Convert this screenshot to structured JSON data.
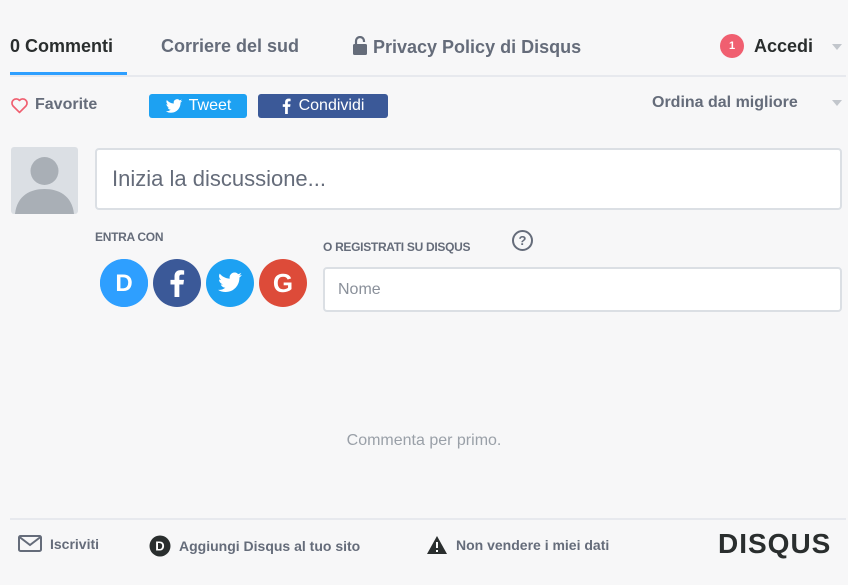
{
  "nav": {
    "comments_tab": "0 Commenti",
    "community_tab": "Corriere del sud",
    "privacy_tab": "Privacy Policy di Disqus",
    "notification_count": "1",
    "login": "Accedi"
  },
  "actions": {
    "favorite": "Favorite",
    "tweet": "Tweet",
    "share": "Condividi",
    "sort": "Ordina dal migliore"
  },
  "composer": {
    "placeholder": "Inizia la discussione..."
  },
  "login": {
    "label": "ENTRA CON",
    "register_label": "O REGISTRATI SU DISQUS",
    "help": "?",
    "name_placeholder": "Nome",
    "providers": [
      {
        "name": "disqus",
        "letter": "D",
        "color": "#2e9fff"
      },
      {
        "name": "facebook",
        "letter": "f",
        "color": "#3b5998"
      },
      {
        "name": "twitter",
        "letter": "",
        "color": "#1da1f2"
      },
      {
        "name": "google",
        "letter": "G",
        "color": "#dd4b39"
      }
    ]
  },
  "empty_state": "Commenta per primo.",
  "footer": {
    "subscribe": "Iscriviti",
    "add_disqus": "Aggiungi Disqus al tuo sito",
    "dont_sell": "Non vendere i miei dati",
    "logo": "DISQUS"
  },
  "colors": {
    "accent": "#2e9fff",
    "badge": "#f05f70",
    "twitter": "#1da1f2",
    "facebook": "#3b5998",
    "text": "#2a2e2e",
    "muted": "#656c7a"
  }
}
